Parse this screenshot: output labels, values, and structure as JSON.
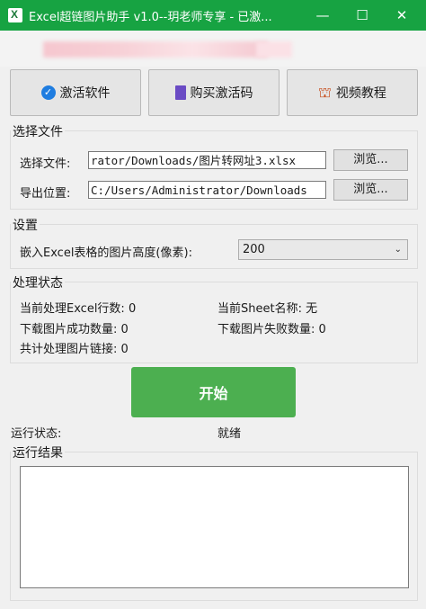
{
  "window": {
    "title": "Excel超链图片助手 v1.0--玥老师专享 - 已激...",
    "min_icon": "—",
    "max_icon": "☐",
    "close_icon": "✕"
  },
  "toolbar": {
    "activate_label": "激活软件",
    "buy_label": "购买激活码",
    "video_label": "视频教程"
  },
  "file_group": {
    "title": "选择文件",
    "select_file_label": "选择文件:",
    "select_file_value": "rator/Downloads/图片转网址3.xlsx",
    "browse1_label": "浏览...",
    "export_label": "导出位置:",
    "export_value": "C:/Users/Administrator/Downloads",
    "browse2_label": "浏览..."
  },
  "settings_group": {
    "title": "设置",
    "height_label": "嵌入Excel表格的图片高度(像素):",
    "height_value": "200"
  },
  "status_group": {
    "title": "处理状态",
    "rows_label": "当前处理Excel行数: 0",
    "sheet_label": "当前Sheet名称: 无",
    "success_label": "下载图片成功数量: 0",
    "fail_label": "下载图片失败数量: 0",
    "total_label": "共计处理图片链接: 0"
  },
  "start_label": "开始",
  "run_status": {
    "label": "运行状态:",
    "value": "就绪"
  },
  "results_group": {
    "title": "运行结果"
  },
  "colors": {
    "titlebar": "#17a342",
    "start_button": "#4caf50"
  },
  "icons": {
    "activate": "check-circle-icon",
    "buy": "document-icon",
    "video": "video-icon"
  }
}
